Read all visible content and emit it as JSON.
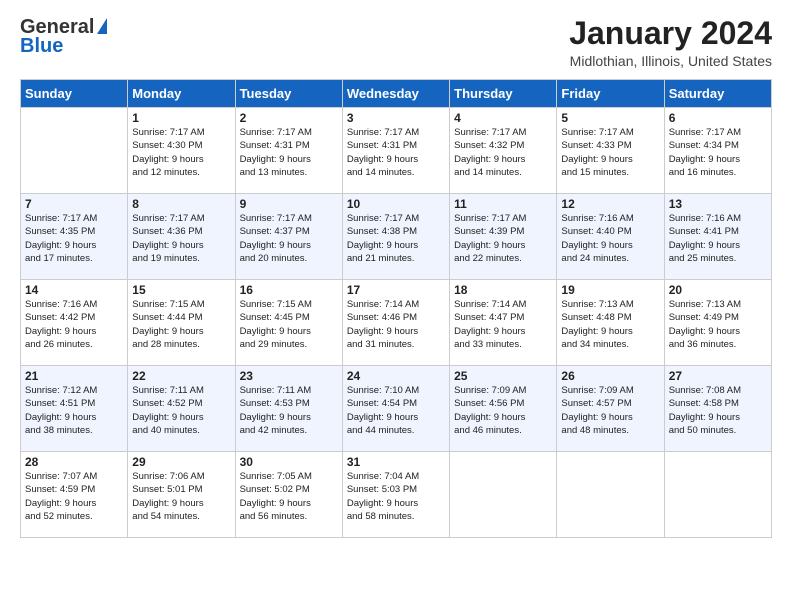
{
  "header": {
    "logo_general": "General",
    "logo_blue": "Blue",
    "title": "January 2024",
    "subtitle": "Midlothian, Illinois, United States"
  },
  "weekdays": [
    "Sunday",
    "Monday",
    "Tuesday",
    "Wednesday",
    "Thursday",
    "Friday",
    "Saturday"
  ],
  "rows": [
    [
      {
        "day": "",
        "lines": []
      },
      {
        "day": "1",
        "lines": [
          "Sunrise: 7:17 AM",
          "Sunset: 4:30 PM",
          "Daylight: 9 hours",
          "and 12 minutes."
        ]
      },
      {
        "day": "2",
        "lines": [
          "Sunrise: 7:17 AM",
          "Sunset: 4:31 PM",
          "Daylight: 9 hours",
          "and 13 minutes."
        ]
      },
      {
        "day": "3",
        "lines": [
          "Sunrise: 7:17 AM",
          "Sunset: 4:31 PM",
          "Daylight: 9 hours",
          "and 14 minutes."
        ]
      },
      {
        "day": "4",
        "lines": [
          "Sunrise: 7:17 AM",
          "Sunset: 4:32 PM",
          "Daylight: 9 hours",
          "and 14 minutes."
        ]
      },
      {
        "day": "5",
        "lines": [
          "Sunrise: 7:17 AM",
          "Sunset: 4:33 PM",
          "Daylight: 9 hours",
          "and 15 minutes."
        ]
      },
      {
        "day": "6",
        "lines": [
          "Sunrise: 7:17 AM",
          "Sunset: 4:34 PM",
          "Daylight: 9 hours",
          "and 16 minutes."
        ]
      }
    ],
    [
      {
        "day": "7",
        "lines": [
          "Sunrise: 7:17 AM",
          "Sunset: 4:35 PM",
          "Daylight: 9 hours",
          "and 17 minutes."
        ]
      },
      {
        "day": "8",
        "lines": [
          "Sunrise: 7:17 AM",
          "Sunset: 4:36 PM",
          "Daylight: 9 hours",
          "and 19 minutes."
        ]
      },
      {
        "day": "9",
        "lines": [
          "Sunrise: 7:17 AM",
          "Sunset: 4:37 PM",
          "Daylight: 9 hours",
          "and 20 minutes."
        ]
      },
      {
        "day": "10",
        "lines": [
          "Sunrise: 7:17 AM",
          "Sunset: 4:38 PM",
          "Daylight: 9 hours",
          "and 21 minutes."
        ]
      },
      {
        "day": "11",
        "lines": [
          "Sunrise: 7:17 AM",
          "Sunset: 4:39 PM",
          "Daylight: 9 hours",
          "and 22 minutes."
        ]
      },
      {
        "day": "12",
        "lines": [
          "Sunrise: 7:16 AM",
          "Sunset: 4:40 PM",
          "Daylight: 9 hours",
          "and 24 minutes."
        ]
      },
      {
        "day": "13",
        "lines": [
          "Sunrise: 7:16 AM",
          "Sunset: 4:41 PM",
          "Daylight: 9 hours",
          "and 25 minutes."
        ]
      }
    ],
    [
      {
        "day": "14",
        "lines": [
          "Sunrise: 7:16 AM",
          "Sunset: 4:42 PM",
          "Daylight: 9 hours",
          "and 26 minutes."
        ]
      },
      {
        "day": "15",
        "lines": [
          "Sunrise: 7:15 AM",
          "Sunset: 4:44 PM",
          "Daylight: 9 hours",
          "and 28 minutes."
        ]
      },
      {
        "day": "16",
        "lines": [
          "Sunrise: 7:15 AM",
          "Sunset: 4:45 PM",
          "Daylight: 9 hours",
          "and 29 minutes."
        ]
      },
      {
        "day": "17",
        "lines": [
          "Sunrise: 7:14 AM",
          "Sunset: 4:46 PM",
          "Daylight: 9 hours",
          "and 31 minutes."
        ]
      },
      {
        "day": "18",
        "lines": [
          "Sunrise: 7:14 AM",
          "Sunset: 4:47 PM",
          "Daylight: 9 hours",
          "and 33 minutes."
        ]
      },
      {
        "day": "19",
        "lines": [
          "Sunrise: 7:13 AM",
          "Sunset: 4:48 PM",
          "Daylight: 9 hours",
          "and 34 minutes."
        ]
      },
      {
        "day": "20",
        "lines": [
          "Sunrise: 7:13 AM",
          "Sunset: 4:49 PM",
          "Daylight: 9 hours",
          "and 36 minutes."
        ]
      }
    ],
    [
      {
        "day": "21",
        "lines": [
          "Sunrise: 7:12 AM",
          "Sunset: 4:51 PM",
          "Daylight: 9 hours",
          "and 38 minutes."
        ]
      },
      {
        "day": "22",
        "lines": [
          "Sunrise: 7:11 AM",
          "Sunset: 4:52 PM",
          "Daylight: 9 hours",
          "and 40 minutes."
        ]
      },
      {
        "day": "23",
        "lines": [
          "Sunrise: 7:11 AM",
          "Sunset: 4:53 PM",
          "Daylight: 9 hours",
          "and 42 minutes."
        ]
      },
      {
        "day": "24",
        "lines": [
          "Sunrise: 7:10 AM",
          "Sunset: 4:54 PM",
          "Daylight: 9 hours",
          "and 44 minutes."
        ]
      },
      {
        "day": "25",
        "lines": [
          "Sunrise: 7:09 AM",
          "Sunset: 4:56 PM",
          "Daylight: 9 hours",
          "and 46 minutes."
        ]
      },
      {
        "day": "26",
        "lines": [
          "Sunrise: 7:09 AM",
          "Sunset: 4:57 PM",
          "Daylight: 9 hours",
          "and 48 minutes."
        ]
      },
      {
        "day": "27",
        "lines": [
          "Sunrise: 7:08 AM",
          "Sunset: 4:58 PM",
          "Daylight: 9 hours",
          "and 50 minutes."
        ]
      }
    ],
    [
      {
        "day": "28",
        "lines": [
          "Sunrise: 7:07 AM",
          "Sunset: 4:59 PM",
          "Daylight: 9 hours",
          "and 52 minutes."
        ]
      },
      {
        "day": "29",
        "lines": [
          "Sunrise: 7:06 AM",
          "Sunset: 5:01 PM",
          "Daylight: 9 hours",
          "and 54 minutes."
        ]
      },
      {
        "day": "30",
        "lines": [
          "Sunrise: 7:05 AM",
          "Sunset: 5:02 PM",
          "Daylight: 9 hours",
          "and 56 minutes."
        ]
      },
      {
        "day": "31",
        "lines": [
          "Sunrise: 7:04 AM",
          "Sunset: 5:03 PM",
          "Daylight: 9 hours",
          "and 58 minutes."
        ]
      },
      {
        "day": "",
        "lines": []
      },
      {
        "day": "",
        "lines": []
      },
      {
        "day": "",
        "lines": []
      }
    ]
  ]
}
